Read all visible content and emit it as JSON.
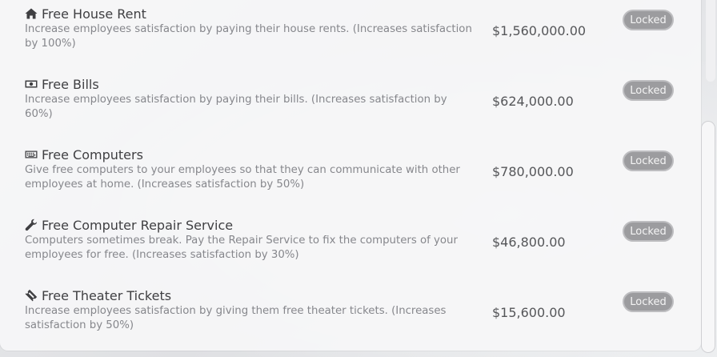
{
  "perks": [
    {
      "icon": "house-icon",
      "title": "Free House Rent",
      "description": "Increase employees satisfaction by paying their house rents. (Increases satisfaction by 100%)",
      "price": "$1,560,000.00",
      "button": "Locked"
    },
    {
      "icon": "money-bill-icon",
      "title": "Free Bills",
      "description": "Increase employees satisfaction by paying their bills. (Increases satisfaction by 60%)",
      "price": "$624,000.00",
      "button": "Locked"
    },
    {
      "icon": "keyboard-icon",
      "title": "Free Computers",
      "description": "Give free computers to your employees so that they can communicate with other employees at home. (Increases satisfaction by 50%)",
      "price": "$780,000.00",
      "button": "Locked"
    },
    {
      "icon": "wrench-icon",
      "title": "Free Computer Repair Service",
      "description": "Computers sometimes break. Pay the Repair Service to fix the computers of your employees for free. (Increases satisfaction by 30%)",
      "price": "$46,800.00",
      "button": "Locked"
    },
    {
      "icon": "ticket-icon",
      "title": "Free Theater Tickets",
      "description": "Increase employees satisfaction by giving them free theater tickets. (Increases satisfaction by 50%)",
      "price": "$15,600.00",
      "button": "Locked"
    }
  ]
}
